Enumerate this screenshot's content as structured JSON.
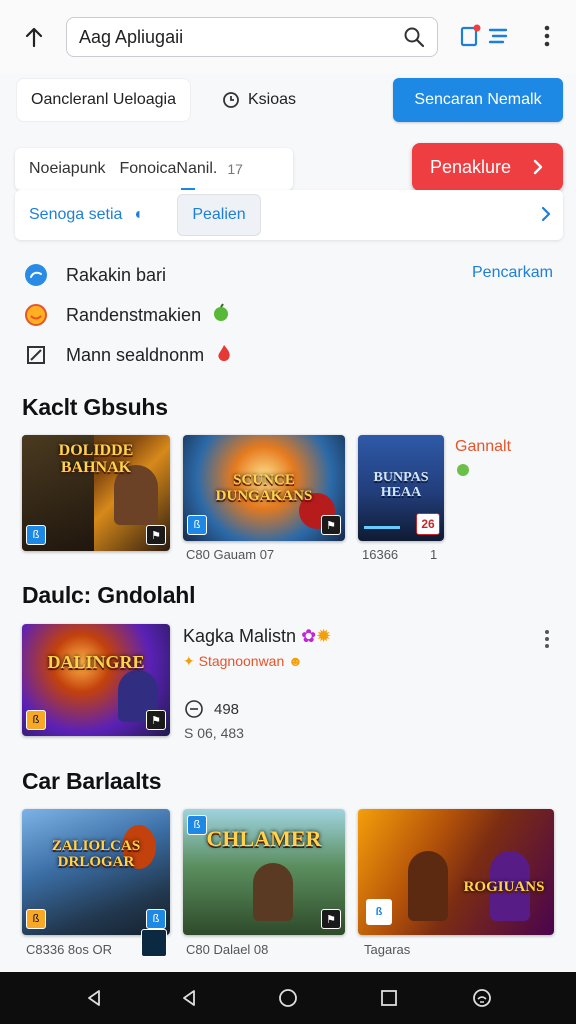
{
  "search": {
    "value": "Aag Apliugaii"
  },
  "filters": {
    "chip1": "Oancleranl Ueloagia",
    "chip2": "Ksioas",
    "blue_button": "Sencaran Nemalk"
  },
  "tabs": {
    "tab1": "Noeiapunk",
    "tab2": "FonoicaNanil.",
    "tab_count": "17",
    "red_button": "Penaklure"
  },
  "subnav": {
    "link": "Senoga setia",
    "pill": "Pealien"
  },
  "categories": {
    "item1": "Rakakin bari",
    "item2": "Randenstmakien",
    "item3": "Mann sealdnonm",
    "link": "Pencarkam"
  },
  "section1": {
    "title": "Kaclt Gbsuhs",
    "thumb1_title": "DOLIDDE BAHNAK",
    "thumb2_title": "SCUNCE DUNGAKANS",
    "thumb3_title": "BUNPAS HEAA",
    "caption1": "C80 Gauam 07",
    "caption2": "16366",
    "caption2b": "1",
    "side_label": "Gannalt",
    "badge3": "26"
  },
  "section2": {
    "title": "Daulc: Gndolahl",
    "thumb_title": "DALINGRE",
    "app_name": "Kagka Malistn",
    "subtitle": "Stagnoonwan",
    "rating": "498",
    "downloads": "S 06, 483"
  },
  "section3": {
    "title": "Car Barlaalts",
    "thumb1_title": "ZALIOLCAS DRLOGAR",
    "thumb2_title": "CHLAMER",
    "thumb3_title": "ROGIUANS",
    "caption1": "C8336 8os OR",
    "caption2": "C80 Dalael 08",
    "caption3": "Tagaras"
  }
}
